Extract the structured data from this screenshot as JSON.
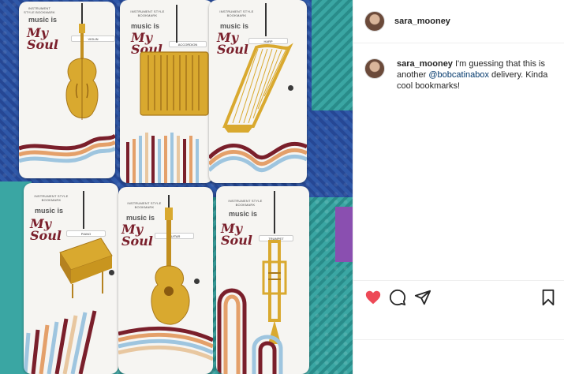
{
  "post": {
    "username": "sara_mooney",
    "caption_prefix": " I'm guessing that this is another ",
    "mention": "@bobcatinabox",
    "caption_suffix": " delivery. Kinda cool bookmarks!"
  },
  "colors": {
    "like": "#ed4956",
    "brand_text": "#7a1f2b",
    "mat_blue": "#2f58a8",
    "mat_teal": "#3aa6a3",
    "gold": "#d9a92f"
  },
  "photo": {
    "cards": [
      {
        "brand": "INSTRUMENT STYLE BOOKMARK",
        "music": "music is",
        "soul": "My Soul",
        "tag": "VIOLIN",
        "icon": "violin-icon"
      },
      {
        "brand": "INSTRUMENT STYLE BOOKMARK",
        "music": "music is",
        "soul": "My Soul",
        "tag": "ACCORDION",
        "icon": "accordion-icon"
      },
      {
        "brand": "INSTRUMENT STYLE BOOKMARK",
        "music": "music is",
        "soul": "My Soul",
        "tag": "HARP",
        "icon": "harp-icon"
      },
      {
        "brand": "INSTRUMENT STYLE BOOKMARK",
        "music": "music is",
        "soul": "My Soul",
        "tag": "PIANO",
        "icon": "piano-icon"
      },
      {
        "brand": "INSTRUMENT STYLE BOOKMARK",
        "music": "music is",
        "soul": "My Soul",
        "tag": "GUITAR",
        "icon": "guitar-icon"
      },
      {
        "brand": "INSTRUMENT STYLE BOOKMARK",
        "music": "music is",
        "soul": "My Soul",
        "tag": "TRUMPET",
        "icon": "trumpet-icon"
      }
    ]
  },
  "actions": {
    "like_icon": "heart-icon",
    "comment_icon": "comment-icon",
    "share_icon": "share-icon",
    "save_icon": "bookmark-icon",
    "liked": true
  }
}
